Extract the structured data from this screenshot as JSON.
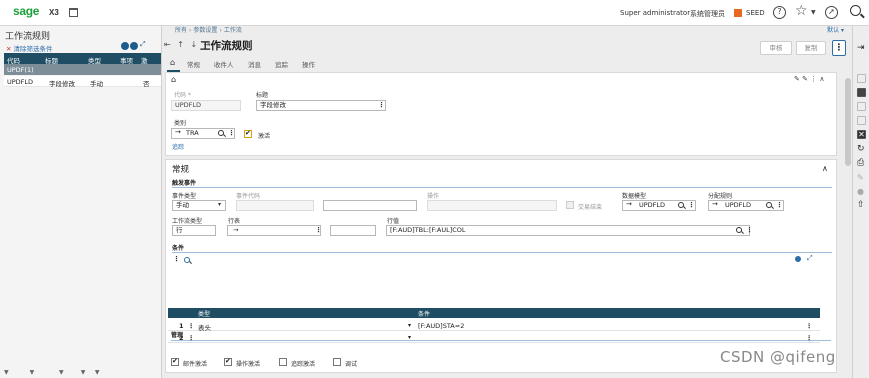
{
  "topbar": {
    "brand": "sage",
    "product": "X3",
    "user": "Super administrator",
    "folder_label": "系统管理员",
    "folder": "SEED",
    "help_glyph": "?"
  },
  "left": {
    "title": "工作流规则",
    "clear_filters": "清除筛选条件",
    "columns": [
      "代码",
      "标题",
      "类型",
      "事项",
      "激"
    ],
    "selected_row": "UPDF(1)",
    "rows": [
      {
        "code": "UPDFLD",
        "title": "字段修改",
        "type": "手动",
        "act": "",
        "x": "否"
      }
    ]
  },
  "main": {
    "breadcrumb": [
      "所有",
      "参数设置",
      "工作流"
    ],
    "default_label": "默认",
    "title": "工作流规则",
    "nav_arrows": "⇤ ↑ ↓ ⇥",
    "actions": {
      "approve": "审核",
      "copy": "复制"
    },
    "tabs": [
      "常规",
      "收件人",
      "消息",
      "追踪",
      "操作"
    ],
    "header": {
      "code_label": "代码 *",
      "code_value": "UPDFLD",
      "title_label": "标题",
      "title_value": "字段修改",
      "category_label": "类别",
      "category_value": "TRA",
      "active_label": "激活",
      "trace_link": "追踪"
    },
    "general": {
      "title": "常规",
      "trigger_title": "触发事件",
      "event_type_label": "事件类型",
      "event_type_value": "手动",
      "event_code_label": "事件代码",
      "operation_label": "操作",
      "tx_end_label": "交易结束",
      "data_model_label": "数据模型",
      "data_model_value": "UPDFLD",
      "assign_rule_label": "分配规则",
      "assign_rule_value": "UPDFLD",
      "wf_type_label": "工作流类型",
      "wf_type_value": "行",
      "table_label": "行表",
      "value_label": "行值",
      "value_value": "[F:AUD]TBL:[F:AUL]COL",
      "conditions_title": "条件",
      "cond_columns": [
        "类型",
        "条件"
      ],
      "cond_rows": [
        {
          "no": "1",
          "type": "表头",
          "cond": "[F:AUD]STA=2"
        },
        {
          "no": "2",
          "type": "",
          "cond": ""
        }
      ],
      "mgmt_title": "管理",
      "mgmt_checks": [
        {
          "label": "邮件激活",
          "checked": true
        },
        {
          "label": "操作激活",
          "checked": true
        },
        {
          "label": "追踪激活",
          "checked": false
        },
        {
          "label": "调试",
          "checked": false
        }
      ]
    }
  },
  "watermark": "CSDN @qifeng"
}
